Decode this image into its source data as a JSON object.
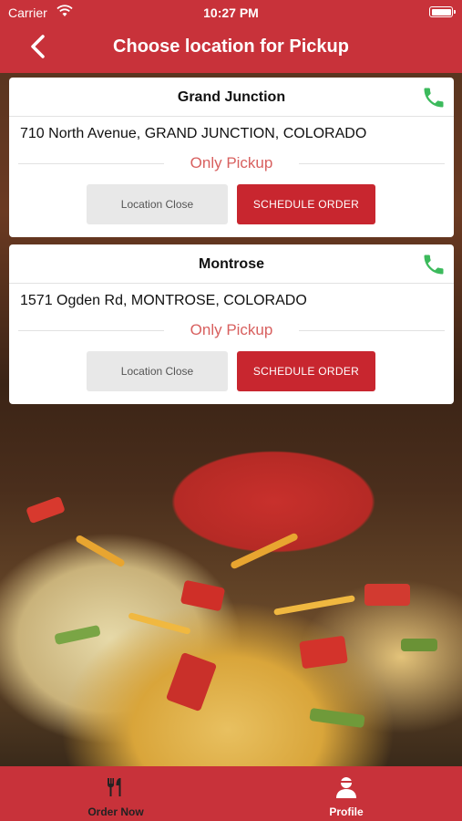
{
  "status_bar": {
    "carrier": "Carrier",
    "time": "10:27 PM"
  },
  "header": {
    "title": "Choose location for Pickup"
  },
  "locations": [
    {
      "name": "Grand Junction",
      "address": "710 North Avenue, GRAND JUNCTION, COLORADO",
      "pickup_label": "Only Pickup",
      "close_label": "Location Close",
      "schedule_label": "SCHEDULE ORDER"
    },
    {
      "name": "Montrose",
      "address": "1571 Ogden Rd, MONTROSE, COLORADO",
      "pickup_label": "Only Pickup",
      "close_label": "Location Close",
      "schedule_label": "SCHEDULE ORDER"
    }
  ],
  "tabbar": {
    "order_now": "Order Now",
    "profile": "Profile"
  },
  "colors": {
    "brand": "#c8323a",
    "pickup_text": "#d8605f",
    "phone_icon": "#3cba5c"
  },
  "icons": {
    "back": "chevron-left-icon",
    "phone": "phone-icon",
    "order_now": "utensils-icon",
    "profile": "user-icon"
  }
}
